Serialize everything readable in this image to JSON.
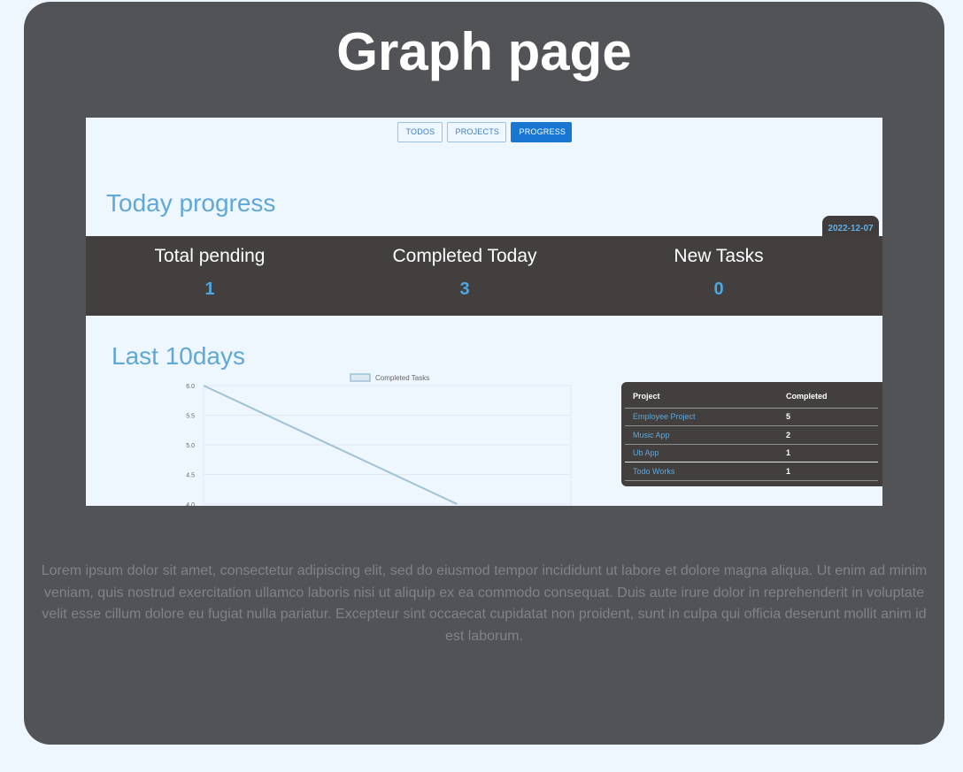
{
  "page": {
    "title": "Graph page"
  },
  "nav": {
    "todos": "TODOS",
    "projects": "PROJECTS",
    "progress": "PROGRESS"
  },
  "today": {
    "title": "Today progress",
    "date": "2022-12-07",
    "stats": [
      {
        "label": "Total pending",
        "value": "1"
      },
      {
        "label": "Completed Today",
        "value": "3"
      },
      {
        "label": "New Tasks",
        "value": "0"
      }
    ]
  },
  "last10": {
    "title": "Last 10days"
  },
  "chart_data": {
    "type": "line",
    "legend": "Completed Tasks",
    "yticks": [
      "6.0",
      "5.5",
      "5.0",
      "4.5",
      "4.0"
    ],
    "ylim_visible": [
      4.0,
      6.0
    ],
    "series": [
      {
        "name": "Completed Tasks",
        "values": [
          6,
          4
        ]
      }
    ],
    "grid": true,
    "legend_position": "top"
  },
  "projects_table": {
    "headers": [
      "Project",
      "Completed"
    ],
    "rows": [
      {
        "project": "Employee Project",
        "completed": "5"
      },
      {
        "project": "Music App",
        "completed": "2"
      },
      {
        "project": "Ub App",
        "completed": "1"
      },
      {
        "project": "Todo Works",
        "completed": "1"
      }
    ]
  },
  "description": "Lorem ipsum dolor sit amet, consectetur adipiscing elit, sed do eiusmod tempor incididunt ut labore et dolore magna aliqua. Ut enim ad minim veniam, quis nostrud exercitation ullamco laboris nisi ut aliquip ex ea commodo consequat. Duis aute irure dolor in reprehenderit in voluptate velit esse cillum dolore eu fugiat nulla pariatur. Excepteur sint occaecat cupidatat non proident, sunt in culpa qui officia deserunt mollit anim id est laborum.",
  "colors": {
    "card": "#525357",
    "accent": "#5fa8d8",
    "stats_bar": "#433f3e",
    "active_nav": "#1976d2",
    "line": "#9ec3d6"
  }
}
